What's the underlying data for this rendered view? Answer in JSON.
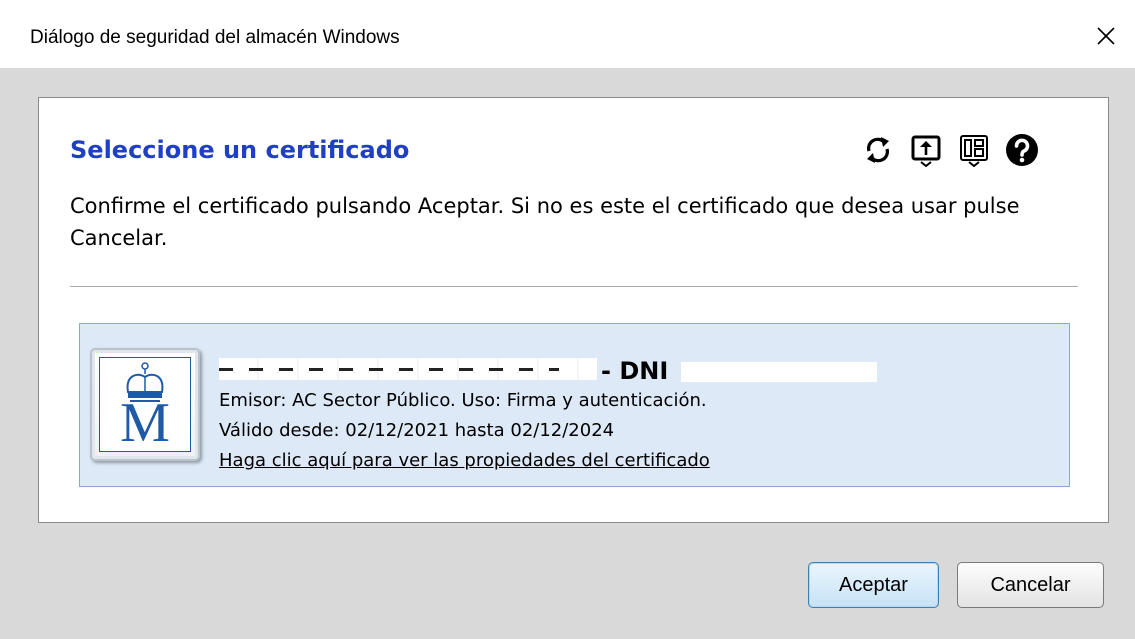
{
  "window": {
    "title": "Diálogo de seguridad del almacén Windows",
    "close_glyph": "✕"
  },
  "dialog": {
    "heading": "Seleccione un certificado",
    "description": "Confirme el certificado pulsando Aceptar. Si no es este el certificado que desea usar pulse Cancelar.",
    "toolbar_icons": [
      "refresh-icon",
      "import-certificate-icon",
      "view-certificates-icon",
      "help-icon"
    ]
  },
  "certificate": {
    "name_suffix": "- DNI",
    "issuer_line": "Emisor: AC Sector Público. Uso: Firma y autenticación.",
    "validity_line": "Válido desde: 02/12/2021 hasta 02/12/2024",
    "properties_link": "Haga clic aquí para ver las propiedades del certificado",
    "logo_letter": "M"
  },
  "buttons": {
    "accept": "Aceptar",
    "cancel": "Cancelar"
  },
  "colors": {
    "heading": "#1f40c2",
    "card_background": "#dde9f7",
    "card_border": "#88a8cf",
    "accent_button_border": "#3c7fb1"
  }
}
